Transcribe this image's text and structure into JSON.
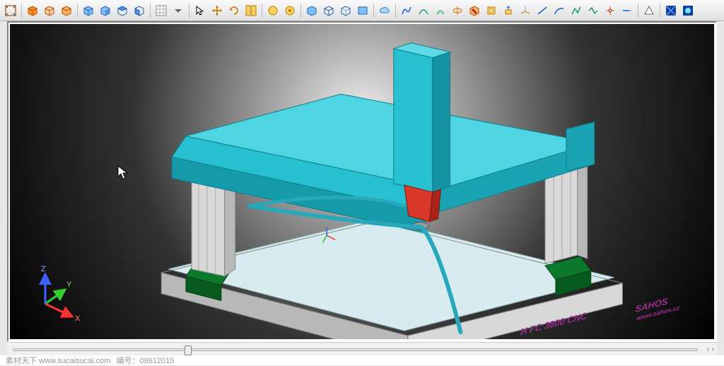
{
  "toolbar": {
    "icons": [
      "fit-view-icon",
      "box-solid-icon",
      "box-hollow-icon",
      "box-alt-icon",
      "box-iso-icon",
      "box-front-icon",
      "box-top-icon",
      "box-side-icon",
      "grid-icon",
      "dropdown-icon",
      "cursor-select-icon",
      "move-icon",
      "rotate-icon",
      "split-view-icon",
      "face-select-icon",
      "face-alt-icon",
      "box-iso2-icon",
      "wireframe-icon",
      "hidden-line-icon",
      "face-mode-icon",
      "cloud-icon",
      "spline-icon",
      "curve-icon",
      "sweep-icon",
      "revolve-icon",
      "cut-icon",
      "hole-icon",
      "extrude-icon",
      "project-icon",
      "line-icon",
      "arc-icon",
      "sketch-icon",
      "path-icon",
      "trim-icon",
      "extend-icon",
      "triangle-icon",
      "render-blue-icon",
      "render-glow-icon"
    ]
  },
  "viewport": {
    "axes": {
      "x": "X",
      "y": "Y",
      "z": "Z"
    },
    "machine": {
      "text_main": "H FC 3800 CNC",
      "brand": "SAHOS",
      "brand_sub": "www.sahos.cz"
    }
  },
  "pager": {
    "prev_label": "‹",
    "next_label": "›"
  },
  "watermark": {
    "site": "素材天下 www.sucaisucai.com",
    "id_label": "编号：",
    "id_value": "08612015"
  }
}
